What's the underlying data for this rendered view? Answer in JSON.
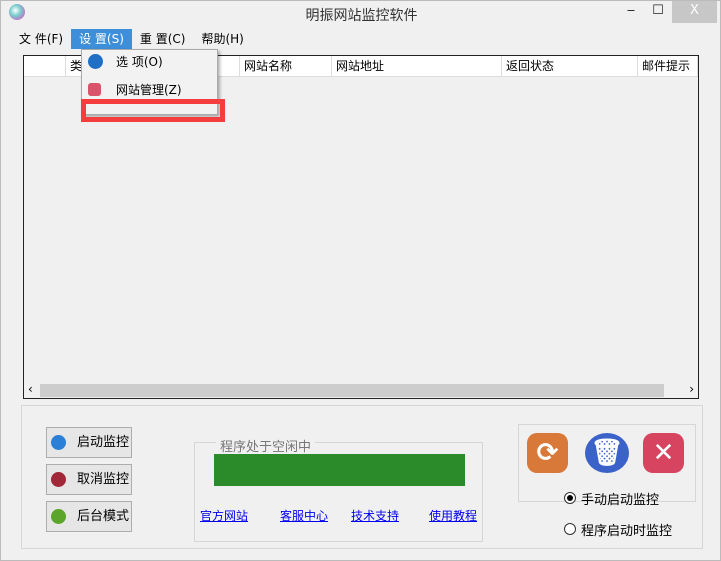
{
  "window": {
    "title": "明振网站监控软件",
    "minimize": "‒",
    "maximize": "☐",
    "close": "X"
  },
  "menu": [
    {
      "label": "文 件(F)"
    },
    {
      "label": "设 置(S)"
    },
    {
      "label": "重 置(C)"
    },
    {
      "label": "帮助(H)"
    }
  ],
  "dropdown": [
    {
      "label": "选 项(O)"
    },
    {
      "label": "网站管理(Z)"
    }
  ],
  "table": {
    "columns": [
      "",
      "类",
      "网站名称",
      "网站地址",
      "返回状态",
      "邮件提示"
    ],
    "scroll_left": "‹",
    "scroll_right": "›"
  },
  "buttons": {
    "start": "启动监控",
    "cancel": "取消监控",
    "background": "后台模式"
  },
  "status": {
    "label": "程序处于空闲中",
    "progress": 100
  },
  "links": [
    "官方网站",
    "客服中心",
    "技术支持",
    "使用教程"
  ],
  "radios": [
    {
      "label": "手动启动监控",
      "checked": true
    },
    {
      "label": "程序启动时监控",
      "checked": false
    }
  ],
  "colors": {
    "accent": "#3c8fd8",
    "progress": "#2b8b2b",
    "highlight": "#f43d3d"
  }
}
